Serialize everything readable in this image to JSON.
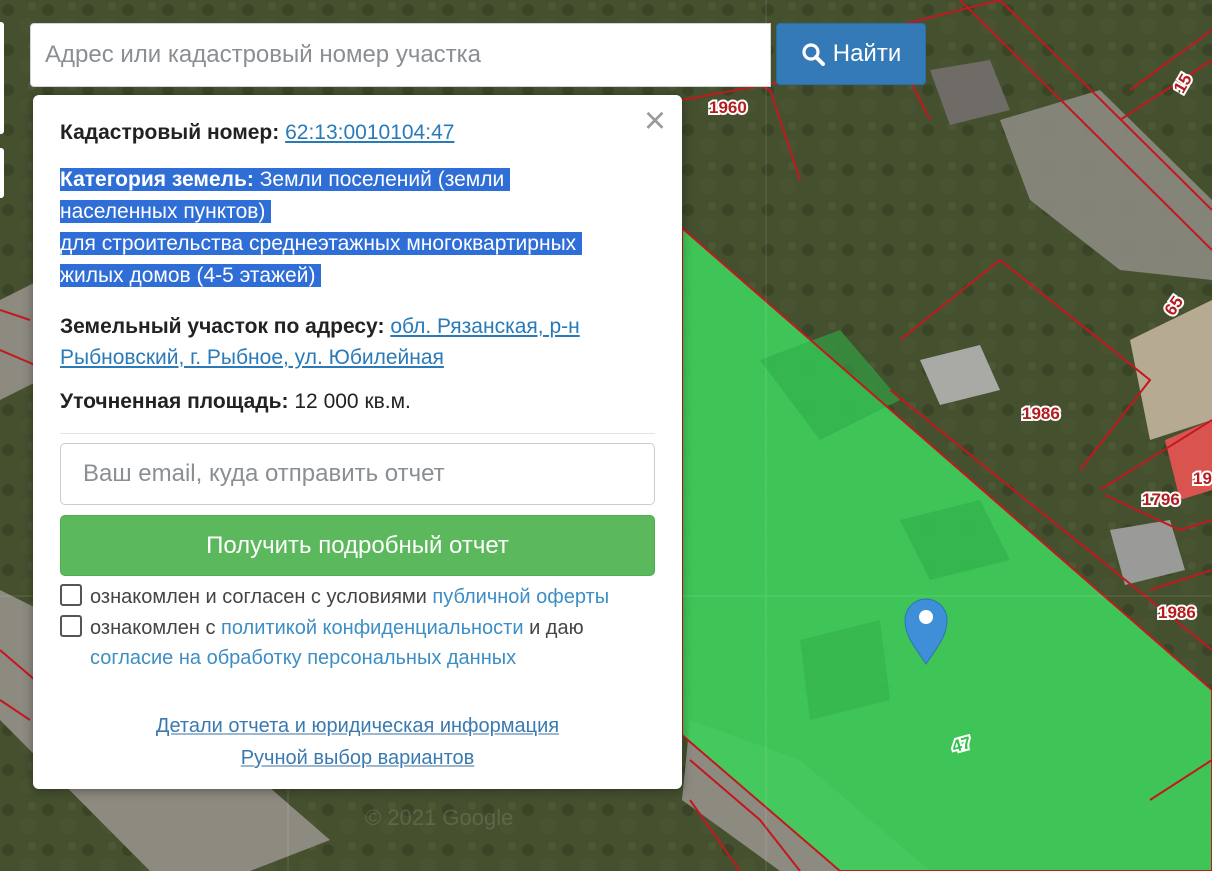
{
  "search": {
    "placeholder": "Адрес или кадастровый номер участка",
    "button_label": "Найти",
    "button_icon": "search-icon"
  },
  "map": {
    "parcel_labels": [
      "1960",
      "15",
      "65",
      "1986",
      "1796",
      "19",
      "1986",
      "47"
    ],
    "watermark": "© 2021 Google",
    "highlight_color": "#3fce5b",
    "boundary_color": "#c2181f",
    "marker_color": "#3f8fd8"
  },
  "popup": {
    "close_symbol": "×",
    "cadastral_label": "Кадастровый номер:",
    "cadastral_number": "62:13:0010104:47",
    "category_label": "Категория земель:",
    "category_line1": "Земли поселений (земли",
    "category_line2": "населенных пунктов)",
    "category_line3": "для строительства среднеэтажных многоквартирных",
    "category_line4": "жилых домов (4-5 этажей)",
    "address_label": "Земельный участок по адресу:",
    "address_line1": "обл. Рязанская, р-н",
    "address_line2": "Рыбновский, г. Рыбное, ул. Юбилейная",
    "area_label": "Уточненная площадь:",
    "area_value": "12 000 кв.м.",
    "email_placeholder": "Ваш email, куда отправить отчет",
    "report_button": "Получить подробный отчет",
    "agree1_text": "ознакомлен и согласен с условиями",
    "agree1_link": "публичной оферты",
    "agree2_text": "ознакомлен с",
    "agree2_link": "политикой конфиденциальности",
    "agree2_text2": "и даю",
    "agree2_link2": "согласие на обработку персональных данных",
    "details_link": "Детали отчета и юридическая информация",
    "manual_link": "Ручной выбор вариантов"
  }
}
